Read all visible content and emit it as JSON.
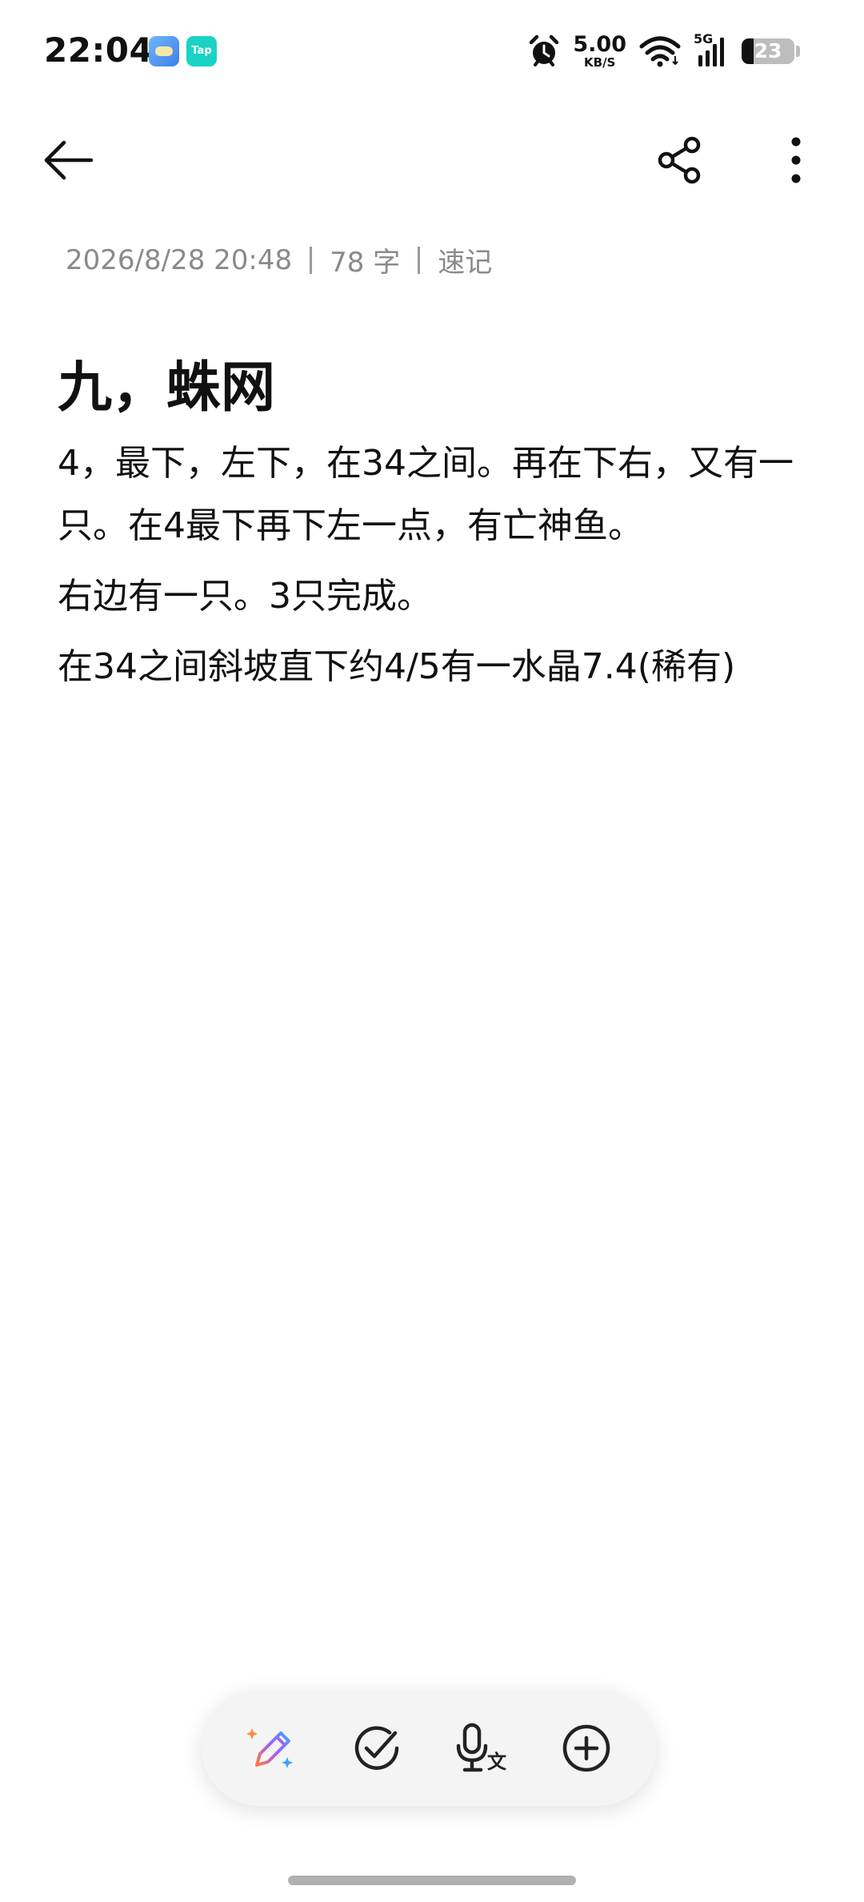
{
  "status_bar": {
    "time": "22:04",
    "tap_app_label": "Tap",
    "net_speed_value": "5.00",
    "net_speed_unit": "KB/S",
    "network_type": "5G",
    "battery_level": "23"
  },
  "note": {
    "meta": {
      "datetime": "2026/8/28 20:48",
      "word_count": "78 字",
      "category": "速记"
    },
    "title": "九，蛛网",
    "paragraphs": [
      "4，最下，左下，在34之间。再在下右，又有一只。在4最下再下左一点，有亡神鱼。",
      "右边有一只。3只完成。",
      "在34之间斜坡直下约4/5有一水晶7.4(稀有)"
    ]
  },
  "toolbar": {
    "icons": {
      "back": "arrow-left-icon",
      "share": "share-icon",
      "more": "more-vertical-icon"
    }
  },
  "bottom_tools": {
    "icons": [
      "ai-pen-icon",
      "checklist-icon",
      "voice-to-text-icon",
      "add-icon"
    ],
    "ai_gradient_colors": [
      "#ff7a3d",
      "#a35cff",
      "#3da5ff"
    ]
  }
}
